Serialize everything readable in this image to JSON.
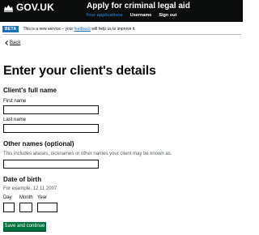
{
  "header": {
    "logo_text": "GOV.UK",
    "service_name": "Apply for criminal legal aid",
    "nav": [
      {
        "label": "Your applications",
        "active": true
      },
      {
        "label": "Username",
        "active": false
      },
      {
        "label": "Sign out",
        "active": false
      }
    ]
  },
  "phase_banner": {
    "tag": "BETA",
    "text_before": "This is a new service – your ",
    "link": "feedback",
    "text_after": " will help us to improve it."
  },
  "back_link": "Back",
  "page_title": "Enter your client's details",
  "full_name": {
    "legend": "Client's full name",
    "first_name_label": "First name",
    "last_name_label": "Last name"
  },
  "other_names": {
    "legend": "Other names (optional)",
    "hint": "This includes aliases, nicknames or other names your client may be known as."
  },
  "dob": {
    "legend": "Date of birth",
    "hint": "For example, 12 11 2007",
    "day_label": "Day",
    "month_label": "Month",
    "year_label": "Year"
  },
  "submit_label": "Save and continue",
  "colors": {
    "header_bg": "#0b0c0c",
    "link_blue": "#1d70b8",
    "button_green": "#00703c",
    "hint_grey": "#505a5f"
  }
}
